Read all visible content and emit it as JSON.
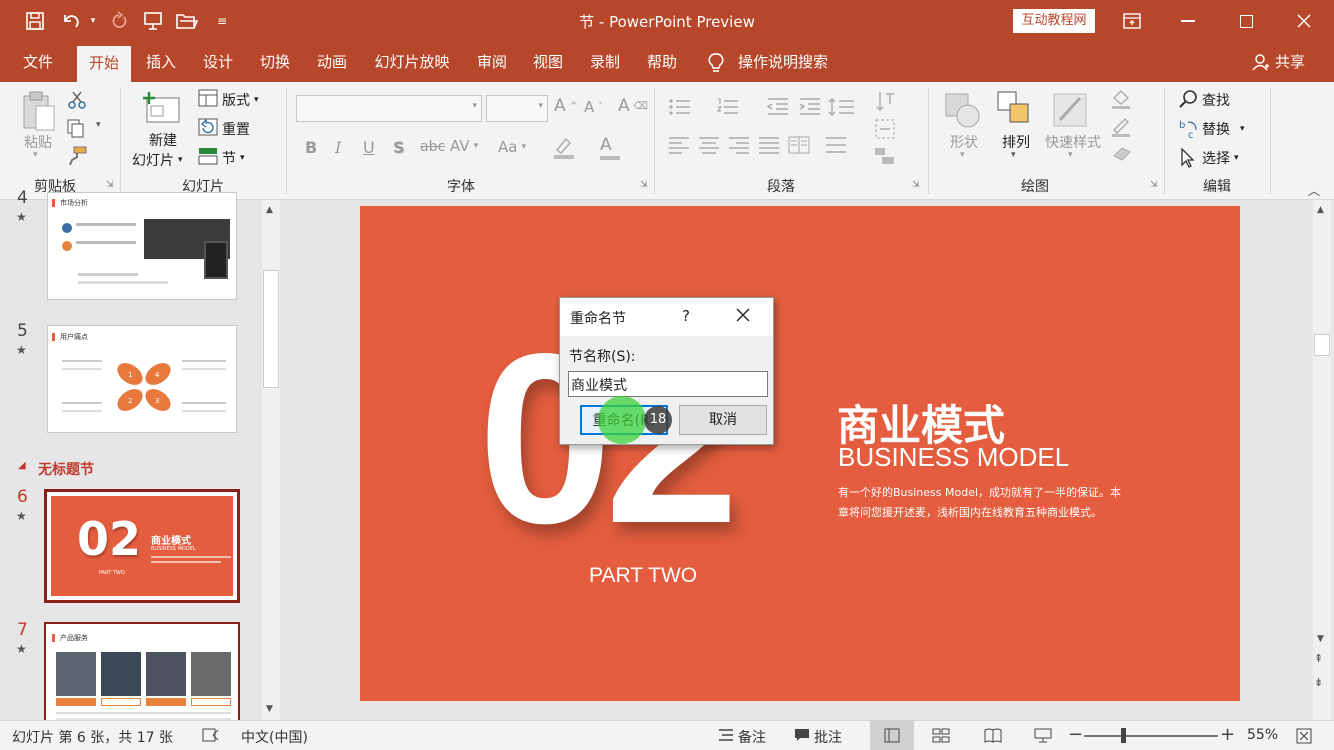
{
  "app": {
    "title": "节 - PowerPoint Preview",
    "brand_badge": "互动教程网"
  },
  "tabs": [
    "文件",
    "开始",
    "插入",
    "设计",
    "切换",
    "动画",
    "幻灯片放映",
    "审阅",
    "视图",
    "录制",
    "帮助"
  ],
  "tell_me": "操作说明搜索",
  "share": "共享",
  "ribbon": {
    "clipboard": {
      "label": "剪贴板",
      "paste": "粘贴"
    },
    "slides": {
      "label": "幻灯片",
      "new_slide_1": "新建",
      "new_slide_2": "幻灯片",
      "layout": "版式",
      "reset": "重置",
      "section": "节"
    },
    "font": {
      "label": "字体",
      "bold": "B",
      "italic": "I",
      "underline": "U",
      "shadow": "S",
      "strike": "abc",
      "spacing": "AV",
      "case": "Aa",
      "color": "A"
    },
    "paragraph": {
      "label": "段落"
    },
    "drawing": {
      "label": "绘图",
      "shapes": "形状",
      "arrange": "排列",
      "quick_styles": "快速样式"
    },
    "editing": {
      "label": "编辑",
      "find": "查找",
      "replace": "替换",
      "select": "选择"
    }
  },
  "thumbnails": {
    "slide4": {
      "num": "4",
      "title": "市场分析"
    },
    "slide5": {
      "num": "5",
      "title": "用户痛点",
      "petals": [
        "1",
        "2",
        "3",
        "4"
      ]
    },
    "section": "无标题节",
    "slide6": {
      "num": "6",
      "big": "02",
      "title": "商业模式",
      "sub": "BUSINESS MODEL",
      "part": "PART TWO"
    },
    "slide7": {
      "num": "7",
      "title": "产品服务"
    }
  },
  "slide": {
    "big_number": "02",
    "heading": "商业模式",
    "subheading": "BUSINESS MODEL",
    "body_line1": "有一个好的Business Model，成功就有了一半的保证。本",
    "body_line2": "章将问您援开述麦，浅析国内在线教育五种商业模式。",
    "part": "PART TWO"
  },
  "dialog": {
    "title": "重命名节",
    "help": "?",
    "field_label": "节名称(S):",
    "field_value": "商业模式",
    "rename_button": "重命名(R)",
    "cancel_button": "取消",
    "click_badge": "18"
  },
  "status": {
    "slide_info": "幻灯片 第 6 张，共 17 张",
    "language": "中文(中国)",
    "notes": "备注",
    "comments": "批注",
    "zoom": "55%"
  },
  "colors": {
    "accent": "#b7472a",
    "slide_bg": "#e35d3e",
    "selection": "#8b2017"
  }
}
